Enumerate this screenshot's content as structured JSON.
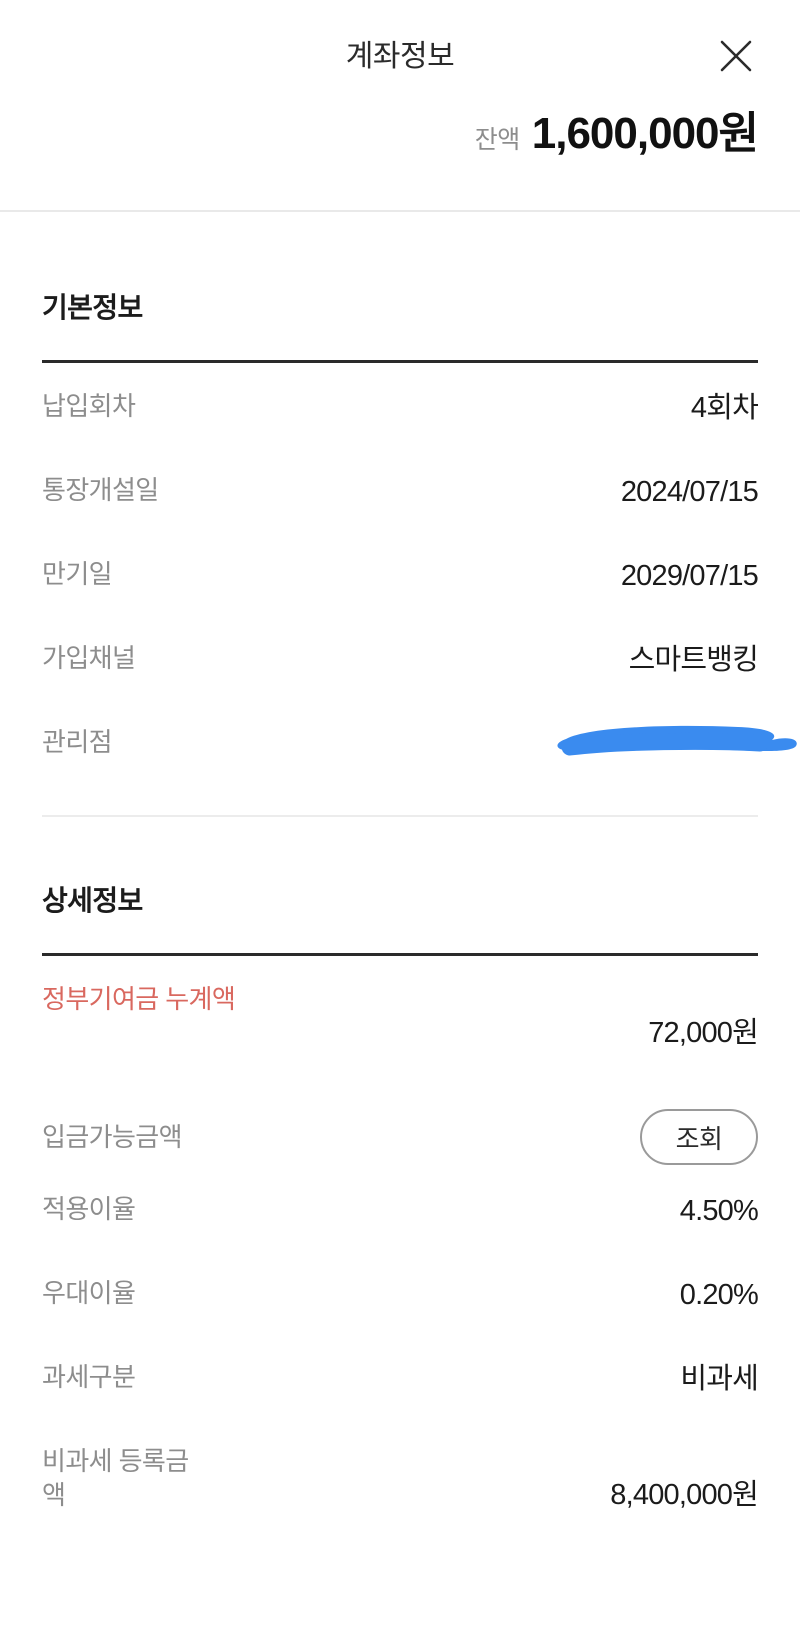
{
  "header": {
    "title": "계좌정보",
    "close_icon": "close-icon",
    "balance_label": "잔액",
    "balance_value": "1,600,000원"
  },
  "basic_section": {
    "title": "기본정보",
    "rows": [
      {
        "label": "납입회차",
        "value": "4회차"
      },
      {
        "label": "통장개설일",
        "value": "2024/07/15"
      },
      {
        "label": "만기일",
        "value": "2029/07/15"
      },
      {
        "label": "가입채널",
        "value": "스마트뱅킹"
      },
      {
        "label": "관리점",
        "value": ""
      }
    ]
  },
  "detail_section": {
    "title": "상세정보",
    "rows": [
      {
        "label": "정부기여금 누계액",
        "value": "72,000원"
      },
      {
        "label": "입금가능금액",
        "value": "조회"
      },
      {
        "label": "적용이율",
        "value": "4.50%"
      },
      {
        "label": "우대이율",
        "value": "0.20%"
      },
      {
        "label": "과세구분",
        "value": "비과세"
      },
      {
        "label": "비과세 등록금액",
        "value": "8,400,000원"
      }
    ]
  },
  "colors": {
    "accent_red": "#d9685f",
    "redaction_blue": "#3a8bef",
    "label_gray": "#8d8d8d",
    "value_black": "#1b1b1b"
  }
}
